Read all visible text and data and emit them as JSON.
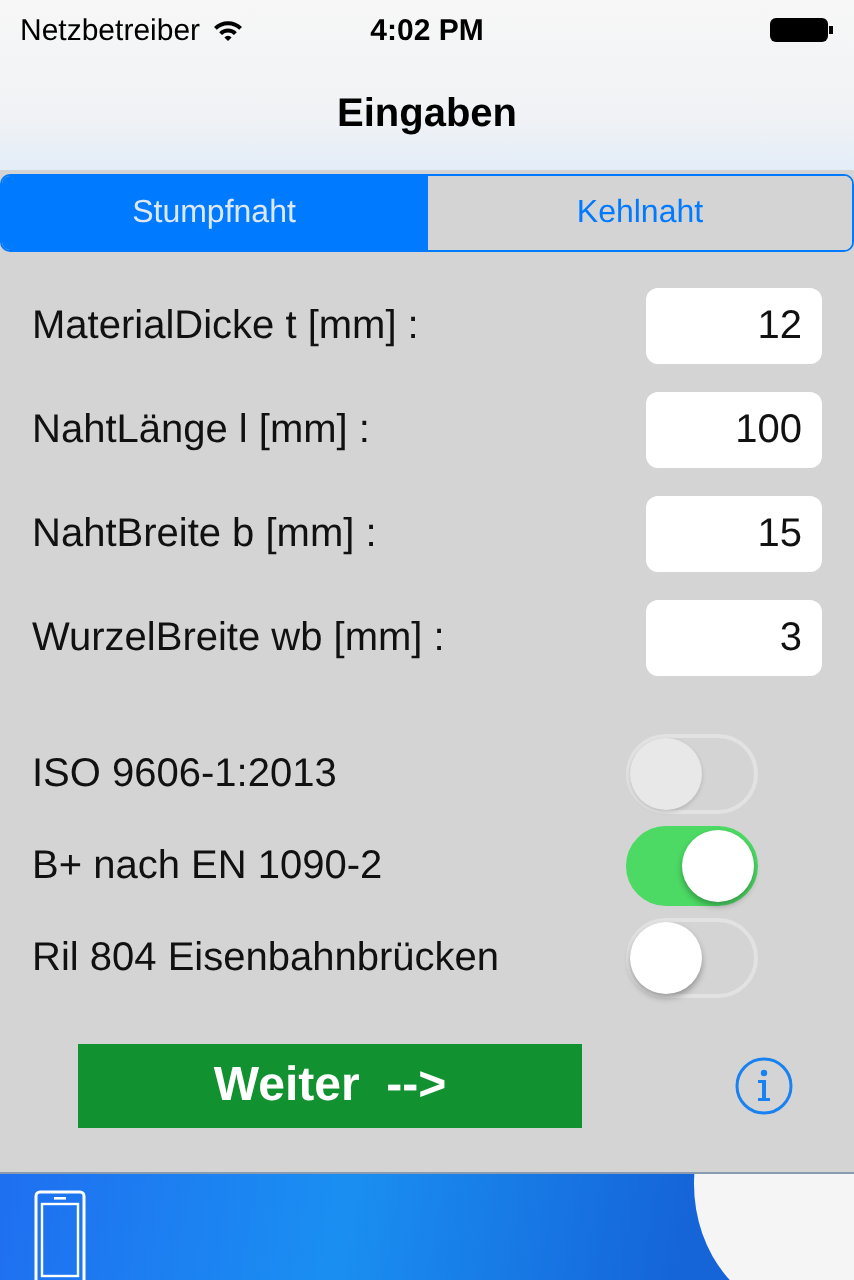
{
  "status_bar": {
    "carrier": "Netzbetreiber",
    "time": "4:02 PM"
  },
  "nav": {
    "title": "Eingaben"
  },
  "tabs": [
    {
      "label": "Stumpfnaht",
      "selected": true
    },
    {
      "label": "Kehlnaht",
      "selected": false
    }
  ],
  "fields": [
    {
      "label": "MaterialDicke t [mm] :",
      "value": "12"
    },
    {
      "label": "NahtLänge l [mm] :",
      "value": "100"
    },
    {
      "label": "NahtBreite b [mm] :",
      "value": "15"
    },
    {
      "label": "WurzelBreite wb [mm] :",
      "value": "3"
    }
  ],
  "switches": [
    {
      "label": "ISO 9606-1:2013",
      "on": false,
      "disabled": true
    },
    {
      "label": "B+ nach EN 1090-2",
      "on": true,
      "disabled": false
    },
    {
      "label": "Ril 804 Eisenbahnbrücken",
      "on": false,
      "disabled": false
    }
  ],
  "button": {
    "label": "Weiter  -->"
  }
}
